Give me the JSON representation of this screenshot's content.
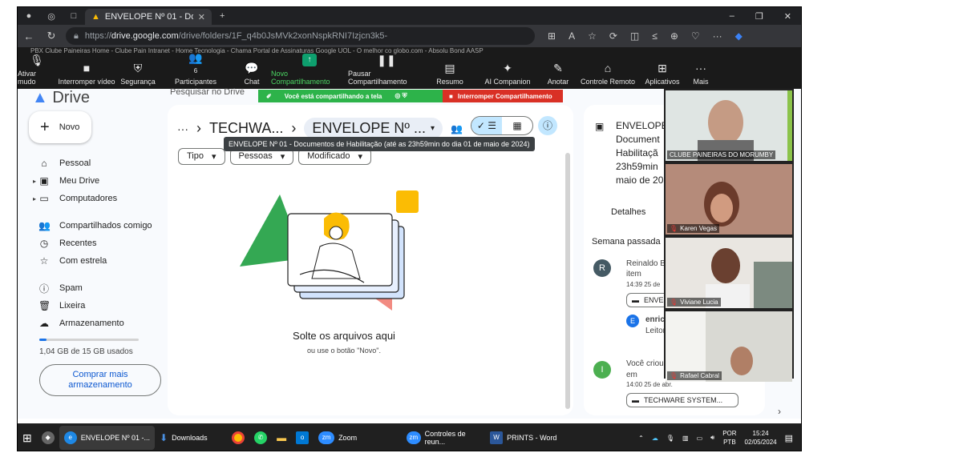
{
  "browser": {
    "tab_title": "ENVELOPE Nº 01 - Documentos",
    "url_prefix": "https://",
    "url_domain": "drive.google.com",
    "url_path": "/drive/folders/1F_q4b0JsMVk2xonNspkRNI7Izjcn3k5-",
    "bookmarks": "PBX Clube Paineiras   Home - Clube Pain   Intranet - Home   Tecnologia - Chama   Portal de Assinaturas   Google   UOL - O melhor co   globo.com - Absolu   Bond   AASP"
  },
  "zoom_toolbar": {
    "items": [
      {
        "label": "Ativar mudo",
        "icon": "🎙"
      },
      {
        "label": "Interromper vídeo",
        "icon": "■"
      },
      {
        "label": "Segurança",
        "icon": "⛨"
      },
      {
        "label": "Participantes",
        "icon": "👥",
        "count": "6"
      },
      {
        "label": "Chat",
        "icon": "💬"
      },
      {
        "label": "Novo Compartilhamento",
        "icon": "↑"
      },
      {
        "label": "Pausar Compartilhamento",
        "icon": "❚❚"
      },
      {
        "label": "Resumo",
        "icon": "▤"
      },
      {
        "label": "AI Companion",
        "icon": "✦"
      },
      {
        "label": "Anotar",
        "icon": "✎"
      },
      {
        "label": "Controle Remoto",
        "icon": "⌂"
      },
      {
        "label": "Aplicativos",
        "icon": "⊞"
      },
      {
        "label": "Mais",
        "icon": "···"
      }
    ],
    "sharing_text": "Você está compartilhando a tela",
    "stop_share": "Interromper Compartilhamento"
  },
  "drive": {
    "logo": "Drive",
    "search_placeholder": "Pesquisar no Drive",
    "new_button": "Novo",
    "sidebar": [
      {
        "label": "Pessoal",
        "icon": "⌂"
      },
      {
        "label": "Meu Drive",
        "icon": "▣"
      },
      {
        "label": "Computadores",
        "icon": "▭"
      },
      {
        "label": "Compartilhados comigo",
        "icon": "👥"
      },
      {
        "label": "Recentes",
        "icon": "◷"
      },
      {
        "label": "Com estrela",
        "icon": "☆"
      },
      {
        "label": "Spam",
        "icon": "ⓘ"
      },
      {
        "label": "Lixeira",
        "icon": "🗑"
      },
      {
        "label": "Armazenamento",
        "icon": "☁"
      }
    ],
    "storage_used_fraction": 0.07,
    "storage_text": "1,04 GB de 15 GB usados",
    "buy_storage": "Comprar mais armazenamento",
    "breadcrumb_parent": "TECHWA...",
    "breadcrumb_current": "ENVELOPE Nº ...",
    "tooltip": "ENVELOPE Nº 01 - Documentos de Habilitação (até as 23h59min do dia 01 de maio de 2024)",
    "filters": [
      "Tipo",
      "Pessoas",
      "Modificado"
    ],
    "drop_title": "Solte os arquivos aqui",
    "drop_subtitle": "ou use o botão \"Novo\"."
  },
  "details": {
    "title_lines": [
      "ENVELOPE",
      "Document",
      "Habilitaçã",
      "23h59min",
      "maio de 20"
    ],
    "tab": "Detalhes",
    "section": "Semana passada",
    "activity1_name": "Reinaldo B",
    "activity1_action": "item",
    "activity1_time": "14:39 25 de",
    "activity1_file": "ENVE",
    "activity1_user": "enric",
    "activity1_role": "Leitor",
    "activity2_action": "Você criou",
    "activity2_in": "em",
    "activity2_time": "14:00 25 de abr.",
    "activity2_file": "TECHWARE SYSTEM..."
  },
  "video": {
    "participants": [
      {
        "name": "CLUBE PAINEIRAS DO MORUMBY",
        "muted": false
      },
      {
        "name": "Karen Vegas",
        "muted": true
      },
      {
        "name": "Viviane Lucia",
        "muted": true
      },
      {
        "name": "Rafael Cabral",
        "muted": true
      }
    ]
  },
  "taskbar": {
    "items": [
      "ENVELOPE Nº 01 -...",
      "Downloads",
      "Zoom",
      "Controles de reun...",
      "PRINTS - Word"
    ],
    "lang": "POR",
    "lang2": "PTB",
    "time": "15:24",
    "date": "02/05/2024"
  }
}
